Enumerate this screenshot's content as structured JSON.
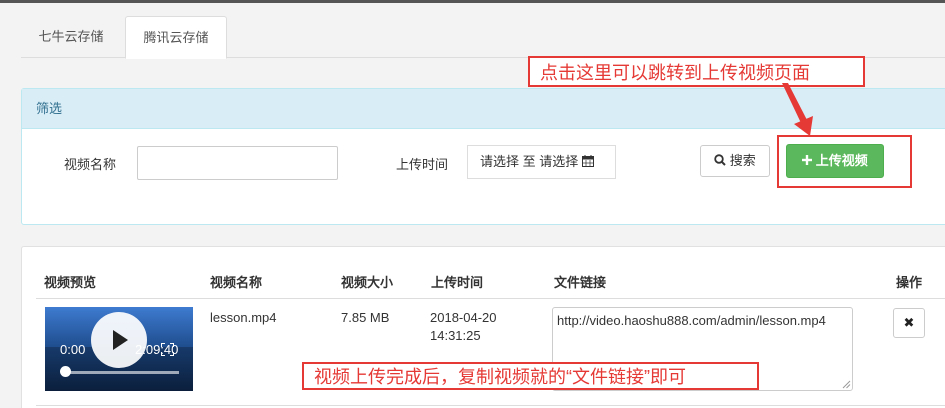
{
  "tabs": [
    {
      "label": "七牛云存储",
      "active": false
    },
    {
      "label": "腾讯云存储",
      "active": true
    }
  ],
  "filter": {
    "title": "筛选",
    "video_name_label": "视频名称",
    "video_name_value": "",
    "upload_time_label": "上传时间",
    "date_start": "请选择",
    "date_to": "至",
    "date_end": "请选择",
    "search_label": "搜索",
    "upload_label": "上传视频"
  },
  "table": {
    "headers": [
      "视频预览",
      "视频名称",
      "视频大小",
      "上传时间",
      "文件链接",
      "操作"
    ],
    "rows": [
      {
        "name": "lesson.mp4",
        "size": "7.85 MB",
        "date": "2018-04-20",
        "time": "14:31:25",
        "link": "http://video.haoshu888.com/admin/lesson.mp4",
        "player_current": "0:00",
        "player_duration": "2:09:40"
      }
    ]
  },
  "annotations": {
    "upload_hint": "点击这里可以跳转到上传视频页面",
    "copy_hint": "视频上传完成后，复制视频就的“文件链接”即可"
  },
  "colors": {
    "annotation_red": "#e53935",
    "upload_green": "#5cb85c",
    "filter_header_bg": "#d9edf7",
    "filter_header_text": "#31708f"
  },
  "icons": {
    "search": "search-icon",
    "calendar": "calendar-icon",
    "plus": "plus-icon",
    "delete": "close-icon",
    "play": "play-icon",
    "fullscreen": "fullscreen-icon"
  }
}
